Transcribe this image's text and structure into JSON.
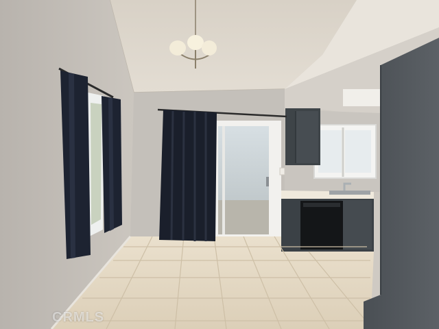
{
  "photo": {
    "subject": "dining-area",
    "watermark": "CRMLS",
    "colors": {
      "wall": "#c9c4bd",
      "ceiling": "#ddd6cc",
      "floor": "#e4d8c3",
      "curtain": "#1c2230",
      "cabinet": "#3c4247",
      "door_glass": "#c4cdd2"
    }
  }
}
